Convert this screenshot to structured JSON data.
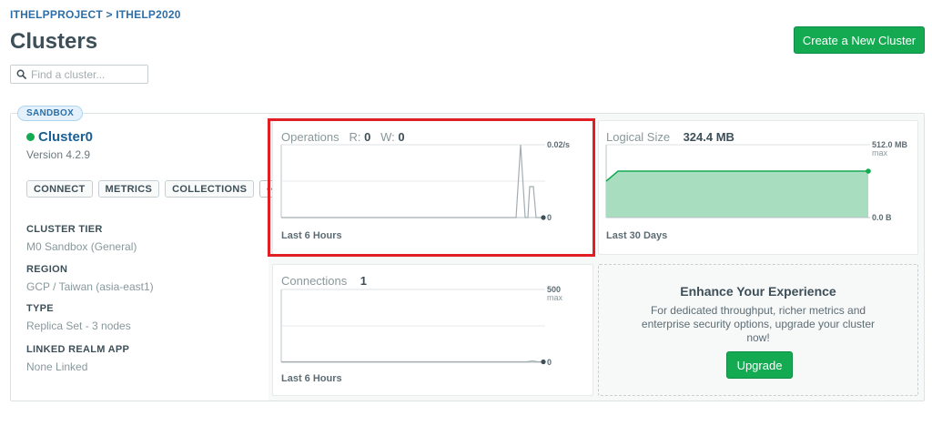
{
  "breadcrumb": "ITHELPPROJECT > ITHELP2020",
  "page_title": "Clusters",
  "create_button": "Create a New Cluster",
  "search": {
    "placeholder": "Find a cluster..."
  },
  "cluster": {
    "badge": "SANDBOX",
    "name": "Cluster0",
    "version": "Version 4.2.9",
    "status_color": "#13aa52",
    "actions": {
      "connect": "CONNECT",
      "metrics": "METRICS",
      "collections": "COLLECTIONS",
      "more": "•••"
    },
    "meta": [
      {
        "label": "CLUSTER TIER",
        "value": "M0 Sandbox (General)"
      },
      {
        "label": "REGION",
        "value": "GCP / Taiwan (asia-east1)"
      },
      {
        "label": "TYPE",
        "value": "Replica Set - 3 nodes"
      },
      {
        "label": "LINKED REALM APP",
        "value": "None Linked"
      }
    ]
  },
  "operations": {
    "title": "Operations",
    "r_label": "R:",
    "r_value": "0",
    "w_label": "W:",
    "w_value": "0",
    "ymax": "0.02/s",
    "ymin": "0",
    "footer": "Last 6 Hours"
  },
  "logical_size": {
    "title": "Logical Size",
    "value": "324.4 MB",
    "ymax": "512.0 MB",
    "ymax_sub": "max",
    "ymin": "0.0 B",
    "footer": "Last 30 Days",
    "color": "#13aa52"
  },
  "connections": {
    "title": "Connections",
    "value": "1",
    "ymax": "500",
    "ymax_sub": "max",
    "ymin": "0",
    "footer": "Last 6 Hours"
  },
  "enhance": {
    "title": "Enhance Your Experience",
    "text": "For dedicated throughput, richer metrics and enterprise security options, upgrade your cluster now!",
    "button": "Upgrade"
  }
}
